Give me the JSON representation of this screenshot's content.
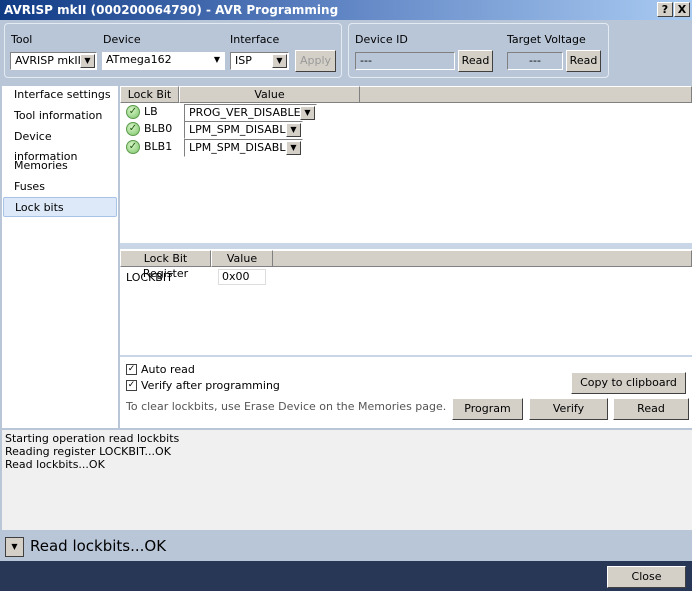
{
  "window": {
    "title": "AVRISP mkII (000200064790) - AVR Programming",
    "help": "?",
    "close": "X"
  },
  "toolbar": {
    "tool_label": "Tool",
    "tool_value": "AVRISP mkII",
    "device_label": "Device",
    "device_value": "ATmega162",
    "interface_label": "Interface",
    "interface_value": "ISP",
    "apply": "Apply",
    "device_id_label": "Device ID",
    "device_id_value": "---",
    "device_id_read": "Read",
    "voltage_label": "Target Voltage",
    "voltage_value": "---",
    "voltage_read": "Read"
  },
  "sidebar": {
    "items": [
      {
        "label": "Interface settings"
      },
      {
        "label": "Tool information"
      },
      {
        "label": "Device information"
      },
      {
        "label": "Memories"
      },
      {
        "label": "Fuses"
      },
      {
        "label": "Lock bits"
      }
    ]
  },
  "lockbits": {
    "headers": [
      "Lock Bit",
      "Value"
    ],
    "rows": [
      {
        "name": "LB",
        "value": "PROG_VER_DISABLED"
      },
      {
        "name": "BLB0",
        "value": "LPM_SPM_DISABLE"
      },
      {
        "name": "BLB1",
        "value": "LPM_SPM_DISABLE"
      }
    ]
  },
  "registers": {
    "headers": [
      "Lock Bit Register",
      "Value"
    ],
    "rows": [
      {
        "name": "LOCKBIT",
        "value": "0x00"
      }
    ]
  },
  "options": {
    "auto_read": "Auto read",
    "verify": "Verify after programming",
    "hint": "To clear lockbits, use Erase Device on the Memories page.",
    "copy": "Copy to clipboard",
    "program": "Program",
    "verify_btn": "Verify",
    "read": "Read"
  },
  "log": [
    "Starting operation read lockbits",
    "Reading register LOCKBIT...OK",
    "Read lockbits...OK"
  ],
  "status": "Read lockbits...OK",
  "footer": {
    "close": "Close"
  }
}
